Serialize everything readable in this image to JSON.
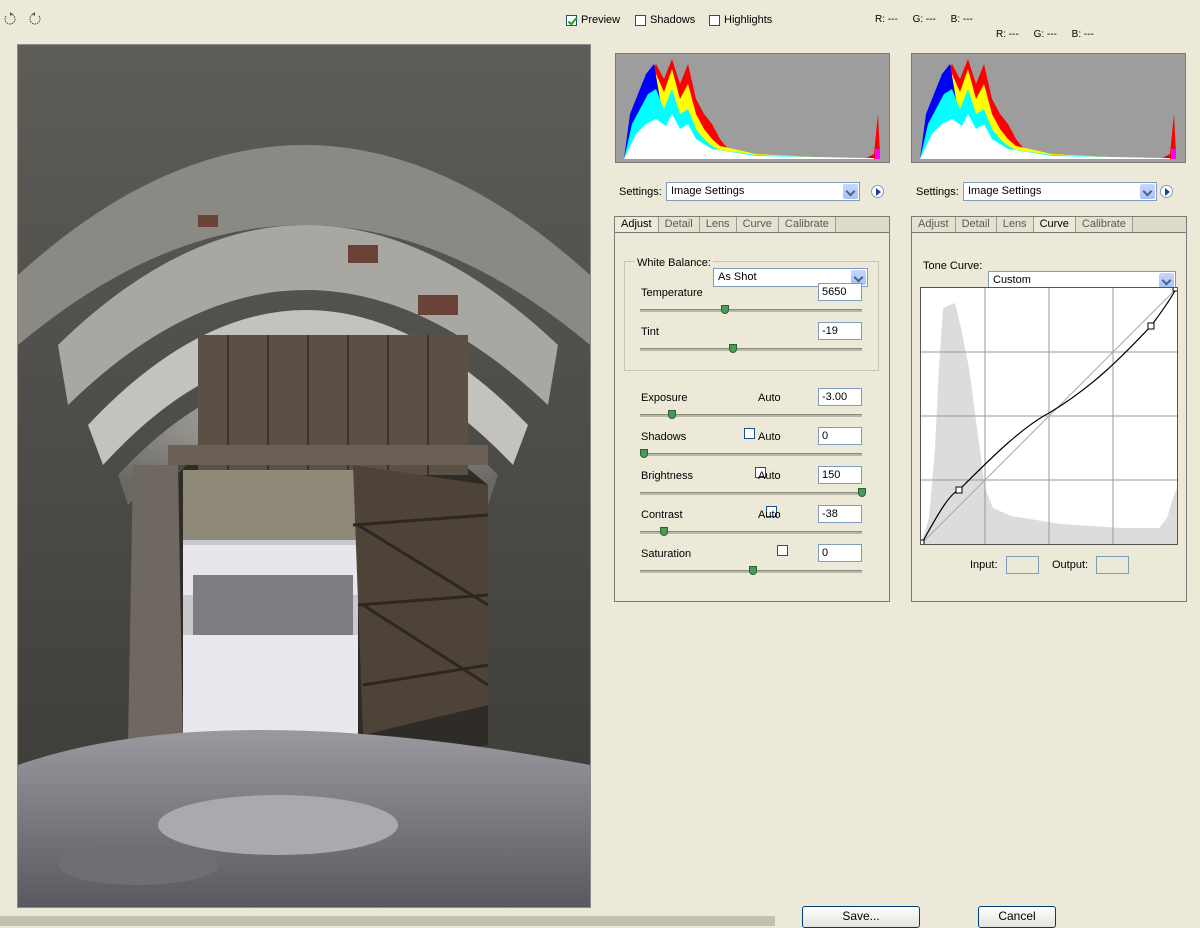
{
  "toolbar": {
    "rotate_left_icon": "rotate-ccw-icon",
    "rotate_right_icon": "rotate-cw-icon",
    "preview": {
      "label": "Preview",
      "checked": true
    },
    "shadows": {
      "label": "Shadows",
      "checked": false
    },
    "highlights": {
      "label": "Highlights",
      "checked": false
    }
  },
  "readout_left": {
    "r": "R: ---",
    "g": "G: ---",
    "b": "B: ---"
  },
  "readout_right": {
    "r": "R: ---",
    "g": "G: ---",
    "b": "B: ---"
  },
  "left_panel": {
    "settings_label": "Settings:",
    "settings_value": "Image Settings",
    "tabs": [
      "Adjust",
      "Detail",
      "Lens",
      "Curve",
      "Calibrate"
    ],
    "active_tab": "Adjust",
    "white_balance": {
      "label": "White Balance:",
      "value": "As Shot"
    },
    "sliders": [
      {
        "label": "Temperature",
        "value": "5650",
        "pos": 0.37,
        "auto": null
      },
      {
        "label": "Tint",
        "value": "-19",
        "pos": 0.41,
        "auto": null
      },
      {
        "label": "Exposure",
        "value": "-3.00",
        "pos": 0.13,
        "auto": "Auto"
      },
      {
        "label": "Shadows",
        "value": "0",
        "pos": 0.0,
        "auto": "Auto"
      },
      {
        "label": "Brightness",
        "value": "150",
        "pos": 1.0,
        "auto": "Auto"
      },
      {
        "label": "Contrast",
        "value": "-38",
        "pos": 0.09,
        "auto": "Auto"
      },
      {
        "label": "Saturation",
        "value": "0",
        "pos": 0.5,
        "auto": null
      }
    ]
  },
  "right_panel": {
    "settings_label": "Settings:",
    "settings_value": "Image Settings",
    "tabs": [
      "Adjust",
      "Detail",
      "Lens",
      "Curve",
      "Calibrate"
    ],
    "active_tab": "Curve",
    "tone_curve": {
      "label": "Tone Curve:",
      "value": "Custom"
    },
    "input_label": "Input:",
    "output_label": "Output:"
  },
  "buttons": {
    "save": "Save...",
    "cancel": "Cancel"
  },
  "colors": {
    "accent_border": "#7f9db9",
    "checkmark": "#21a121",
    "slider_thumb": "#4a9a5a"
  }
}
